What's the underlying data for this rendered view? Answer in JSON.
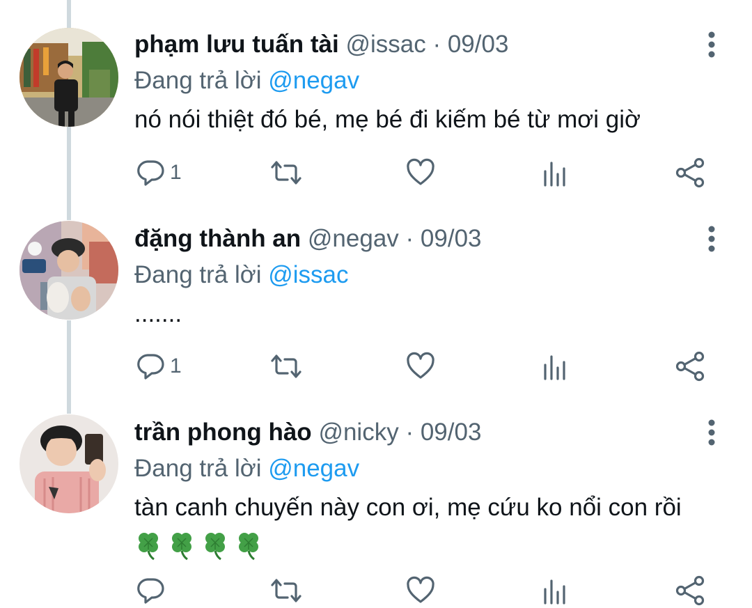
{
  "tweets": [
    {
      "name": "phạm lưu tuấn tài",
      "handle": "@issac",
      "separator": "·",
      "date": "09/03",
      "reply_prefix": "Đang trả lời",
      "reply_to": "@negav",
      "text": "nó nói thiệt đó bé, mẹ bé đi kiếm bé từ mơi giờ",
      "reply_count": "1"
    },
    {
      "name": "đặng thành an",
      "handle": "@negav",
      "separator": "·",
      "date": "09/03",
      "reply_prefix": "Đang trả lời",
      "reply_to": "@issac",
      "text": ".......",
      "reply_count": "1"
    },
    {
      "name": "trần phong hào",
      "handle": "@nicky",
      "separator": "·",
      "date": "09/03",
      "reply_prefix": "Đang trả lời",
      "reply_to": "@negav",
      "text": "tàn canh chuyến này con ơi, mẹ cứu ko nổi con rồi",
      "emoji": [
        "🍀",
        "🍀",
        "🍀",
        "🍀"
      ],
      "reply_count": ""
    }
  ],
  "icons": {
    "reply": "reply-icon",
    "retweet": "retweet-icon",
    "like": "heart-icon",
    "views": "views-icon",
    "share": "share-icon",
    "more": "more-icon",
    "emoji": "four-leaf-clover-emoji"
  },
  "colors": {
    "link": "#1d9bf0",
    "secondary_text": "#536471",
    "primary_text": "#0f1419",
    "thread_line": "#cfd9de"
  }
}
